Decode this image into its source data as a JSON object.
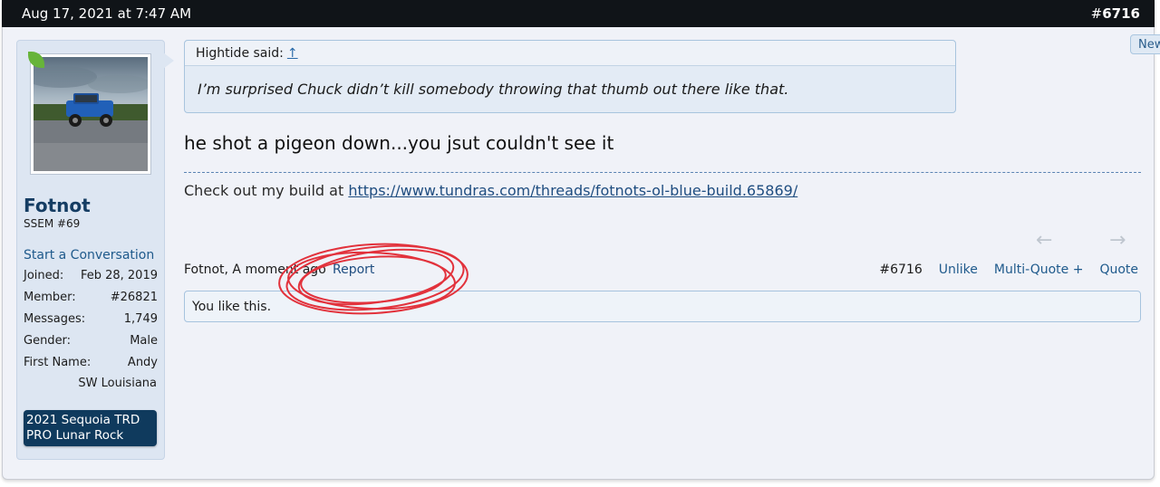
{
  "post": {
    "date": "Aug 17, 2021 at 7:47 AM",
    "number_hash": "#",
    "number": "6716",
    "new_tab_label": "New"
  },
  "user": {
    "name": "Fotnot",
    "title": "SSEM #69",
    "start_conversation": "Start a Conversation",
    "stats": [
      {
        "label": "Joined:",
        "value": "Feb 28, 2019"
      },
      {
        "label": "Member:",
        "value": "#26821"
      },
      {
        "label": "Messages:",
        "value": "1,749"
      },
      {
        "label": "Gender:",
        "value": "Male"
      },
      {
        "label": "First Name:",
        "value": "Andy"
      }
    ],
    "location": "SW Louisiana",
    "vehicle": "2021 Sequoia TRD PRO Lunar Rock"
  },
  "quote": {
    "author_said": "Hightide said:",
    "jump_arrow": "↑",
    "text": "I’m surprised Chuck didn’t kill somebody throwing that thumb out there like that."
  },
  "message": {
    "text": "he shot a pigeon down...you jsut couldn't see it"
  },
  "signature": {
    "prefix": "Check out my build at",
    "link": "https://www.tundras.com/threads/fotnots-ol-blue-build.65869/"
  },
  "footer": {
    "meta": "Fotnot, A moment ago",
    "report": "Report",
    "post_number": "#6716",
    "unlike": "Unlike",
    "multi_quote": "Multi-Quote +",
    "quote": "Quote",
    "prev_icon": "←",
    "next_icon": "→"
  },
  "likes": {
    "text": "You like this."
  },
  "colors": {
    "header_bg": "#101418",
    "link_blue": "#1f5a8c",
    "banner_bg": "#0f3a5d",
    "annotation_red": "#e2323c"
  }
}
